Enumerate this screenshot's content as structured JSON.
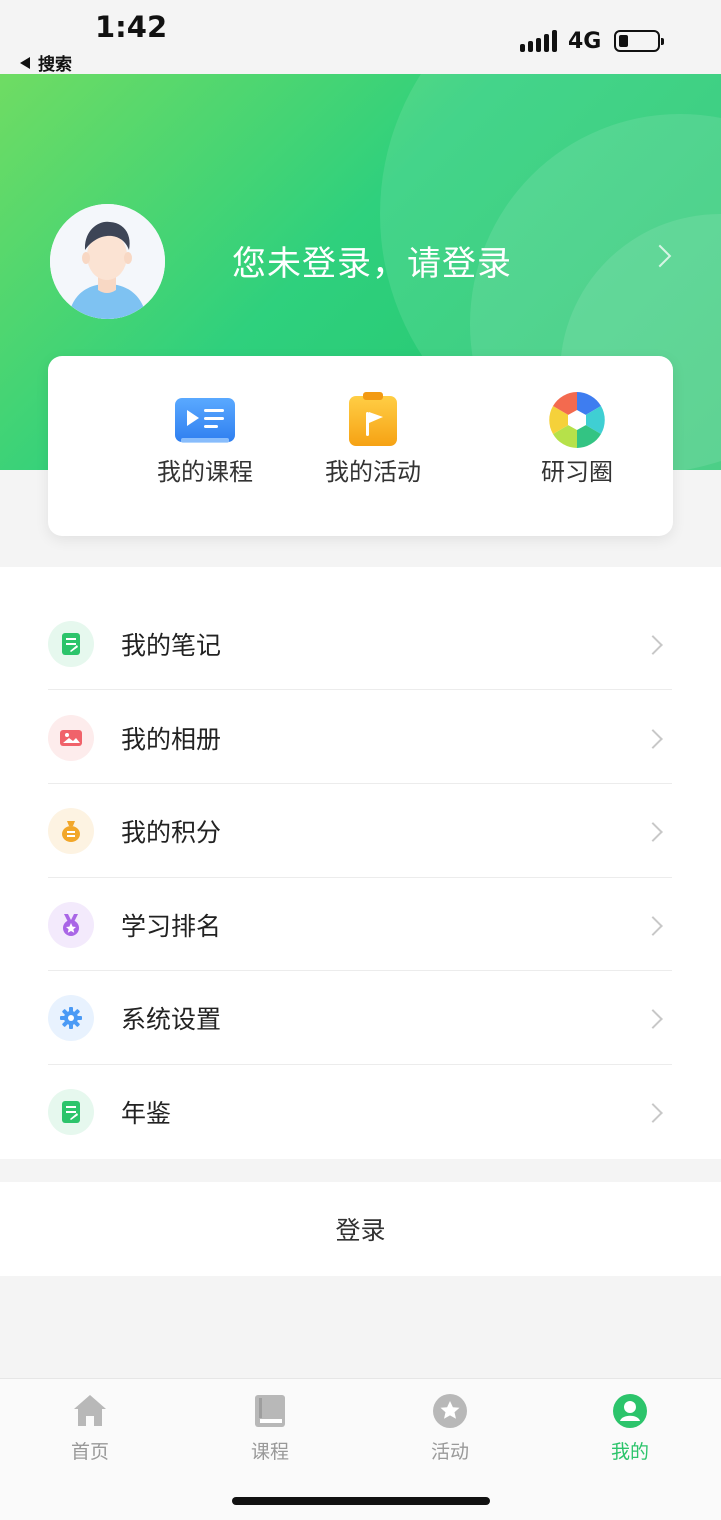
{
  "status_bar": {
    "time": "1:42",
    "back_label": "搜索",
    "network": "4G",
    "battery_level": 0.2
  },
  "header": {
    "login_prompt": "您未登录，请登录"
  },
  "quick_actions": [
    {
      "label": "我的课程",
      "icon": "course-video-icon"
    },
    {
      "label": "我的活动",
      "icon": "activity-clipboard-flag-icon"
    },
    {
      "label": "研习圈",
      "icon": "aperture-circle-icon"
    }
  ],
  "menu": [
    {
      "label": "我的笔记",
      "icon": "note-icon",
      "color": "#2cc46b",
      "bg": "#e6f8ee"
    },
    {
      "label": "我的相册",
      "icon": "photo-album-icon",
      "color": "#f0626a",
      "bg": "#fdecec"
    },
    {
      "label": "我的积分",
      "icon": "points-bag-icon",
      "color": "#f2a72a",
      "bg": "#fdf3e2"
    },
    {
      "label": "学习排名",
      "icon": "medal-icon",
      "color": "#a966e6",
      "bg": "#f3eafc"
    },
    {
      "label": "系统设置",
      "icon": "gear-icon",
      "color": "#4a9af5",
      "bg": "#e8f2fe"
    },
    {
      "label": "年鉴",
      "icon": "yearbook-icon",
      "color": "#2cc46b",
      "bg": "#e6f8ee"
    }
  ],
  "login_button": "登录",
  "tabbar": [
    {
      "label": "首页",
      "icon": "home-icon",
      "active": false
    },
    {
      "label": "课程",
      "icon": "book-icon",
      "active": false
    },
    {
      "label": "活动",
      "icon": "star-circle-icon",
      "active": false
    },
    {
      "label": "我的",
      "icon": "user-circle-icon",
      "active": true
    }
  ],
  "colors": {
    "accent": "#2cc46b",
    "inactive": "#999999"
  }
}
